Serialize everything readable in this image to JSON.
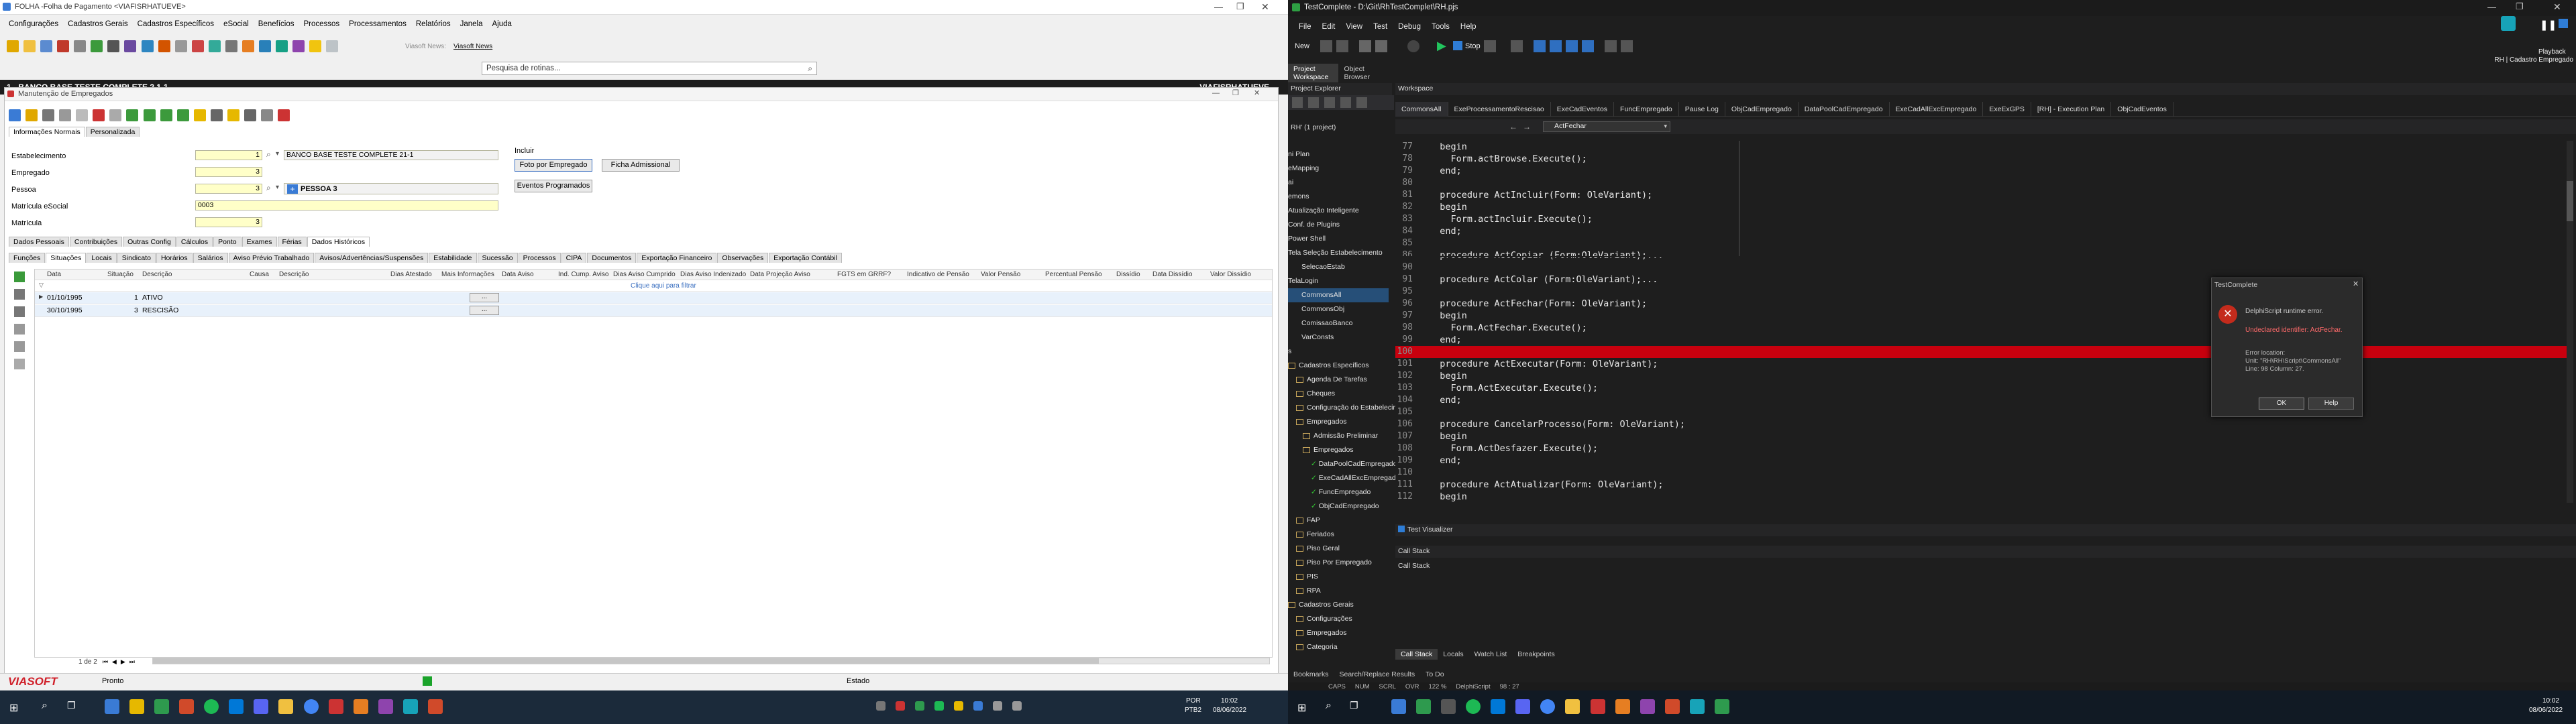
{
  "left": {
    "window_title": "FOLHA -Folha de Pagamento <VIAFISRHATUEVE>",
    "menu": [
      "Configurações",
      "Cadastros Gerais",
      "Cadastros Específicos",
      "eSocial",
      "Benefícios",
      "Processos",
      "Processamentos",
      "Relatórios",
      "Janela",
      "Ajuda"
    ],
    "viasoft_news_label": "Viasoft News:",
    "viasoft_news_link": "Viasoft News",
    "search_placeholder": "Pesquisa de rotinas...",
    "company_bar": "1 - BANCO BASE TESTE COMPLETE 2 1-1",
    "company_user": "VIAFISRHATUEVE",
    "subwindow_title": "Manutenção de Empregados",
    "top_tabs": [
      "Informações Normais",
      "Personalizada"
    ],
    "fields": {
      "estabelecimento_label": "Estabelecimento",
      "estabelecimento_value": "1",
      "estabelecimento_desc": "BANCO BASE TESTE COMPLETE 21-1",
      "empregado_label": "Empregado",
      "empregado_value": "3",
      "pessoa_label": "Pessoa",
      "pessoa_value": "3",
      "pessoa_desc": "PESSOA 3",
      "matricula_esocial_label": "Matrícula eSocial",
      "matricula_esocial_value": "0003",
      "matricula_label": "Matrícula",
      "matricula_value": "3"
    },
    "incluir_label": "Incluir",
    "buttons": [
      "Foto por Empregado",
      "Ficha Admissional",
      "Eventos Programados"
    ],
    "tabs_row1": [
      "Dados Pessoais",
      "Contribuições",
      "Outras Config",
      "Cálculos",
      "Ponto",
      "Exames",
      "Férias",
      "Dados Históricos"
    ],
    "tabs_row2": [
      "Funções",
      "Situações",
      "Locais",
      "Sindicato",
      "Horários",
      "Salários",
      "Aviso Prévio Trabalhado",
      "Avisos/Advertências/Suspensões",
      "Estabilidade",
      "Sucessão",
      "Processos",
      "CIPA",
      "Documentos",
      "Exportação Financeiro",
      "Observações",
      "Exportação Contábil"
    ],
    "grid_headers": [
      "Data",
      "Situação",
      "Descrição",
      "Causa",
      "Descrição",
      "Dias Atestado",
      "Mais Informações",
      "Data Aviso",
      "Ind. Cump. Aviso",
      "Dias Aviso Cumprido",
      "Dias Aviso Indenizado",
      "Data Projeção Aviso",
      "FGTS em GRRF?",
      "Indicativo de Pensão",
      "Valor Pensão",
      "Percentual Pensão",
      "Dissídio",
      "Data Dissídio",
      "Valor Dissídio"
    ],
    "grid_filter_hint": "Clique aqui para filtrar",
    "grid_rows": [
      {
        "data": "01/10/1995",
        "situacao": "1",
        "descricao": "ATIVO",
        "btn": "..."
      },
      {
        "data": "30/10/1995",
        "situacao": "3",
        "descricao": "RESCISÃO",
        "btn": "..."
      }
    ],
    "pager": "1 de 2",
    "status_brand": "VIASOFT",
    "status_text": "Pronto",
    "status_state": "Estado"
  },
  "right": {
    "window_title": "TestComplete - D:\\Git\\RhTestComplet\\RH.pjs",
    "menu": [
      "File",
      "Edit",
      "View",
      "Test",
      "Debug",
      "Tools",
      "Help"
    ],
    "new_label": "New",
    "stop_label": "Stop",
    "playback_label": "Playback",
    "project_label": "RH | Cadastro Empregado",
    "panel_tabs": [
      "Project Workspace",
      "Object Browser"
    ],
    "project_explorer_title": "Project Explorer",
    "project_root": "RH' (1 project)",
    "tree_items": [
      "ni Plan",
      "eMapping",
      "ai",
      "emons",
      "Atualização Inteligente",
      "Conf. de Plugins",
      "Power Shell",
      "Tela Seleção Estabelecimento",
      "SelecaoEstab",
      "TelaLogin",
      "CommonsAll",
      "CommonsObj",
      "ComissaoBanco",
      "VarConsts",
      "s",
      "Cadastros Específicos",
      "Agenda De Tarefas",
      "Cheques",
      "Configuração do Estabelecimento",
      "Empregados",
      "Admissão Preliminar",
      "Empregados",
      "DataPoolCadEmpregado",
      "ExeCadAllExcEmpregado",
      "FuncEmpregado",
      "ObjCadEmpregado",
      "FAP",
      "Feriados",
      "Piso Geral",
      "Piso Por Empregado",
      "PIS",
      "RPA",
      "Cadastros Gerais",
      "Configurações",
      "Empregados",
      "Categoria"
    ],
    "workspace_title": "Workspace",
    "editor_tabs": [
      "CommonsAll",
      "ExeProcessamentoRescisao",
      "ExeCadEventos",
      "FuncEmpregado",
      "Pause Log",
      "ObjCadEmpregado",
      "DataPoolCadEmpregado",
      "ExeCadAllExcEmpregado",
      "ExeExGPS",
      "[RH] - Execution Plan",
      "ObjCadEventos"
    ],
    "breadcrumb_fn": "ActFechar",
    "code_lines": [
      {
        "n": "77",
        "t": "  begin"
      },
      {
        "n": "78",
        "t": "    Form.actBrowse.Execute();"
      },
      {
        "n": "79",
        "t": "  end;"
      },
      {
        "n": "80",
        "t": ""
      },
      {
        "n": "81",
        "t": "  procedure ActIncluir(Form: OleVariant);"
      },
      {
        "n": "82",
        "t": "  begin"
      },
      {
        "n": "83",
        "t": "    Form.actIncluir.Execute();"
      },
      {
        "n": "84",
        "t": "  end;"
      },
      {
        "n": "85",
        "t": ""
      },
      {
        "n": "86",
        "t": "  procedure ActCopiar (Form:OleVariant);..."
      },
      {
        "n": "90",
        "t": ""
      },
      {
        "n": "91",
        "t": "  procedure ActColar (Form:OleVariant);..."
      },
      {
        "n": "95",
        "t": ""
      },
      {
        "n": "96",
        "t": "  procedure ActFechar(Form: OleVariant);"
      },
      {
        "n": "97",
        "t": "  begin"
      },
      {
        "n": "98",
        "t": "    Form.ActFechar.Execute();"
      },
      {
        "n": "99",
        "t": "  end;"
      },
      {
        "n": "100",
        "t": ""
      },
      {
        "n": "101",
        "t": "  procedure ActExecutar(Form: OleVariant);"
      },
      {
        "n": "102",
        "t": "  begin"
      },
      {
        "n": "103",
        "t": "    Form.ActExecutar.Execute();"
      },
      {
        "n": "104",
        "t": "  end;"
      },
      {
        "n": "105",
        "t": ""
      },
      {
        "n": "106",
        "t": "  procedure CancelarProcesso(Form: OleVariant);"
      },
      {
        "n": "107",
        "t": "  begin"
      },
      {
        "n": "108",
        "t": "    Form.ActDesfazer.Execute();"
      },
      {
        "n": "109",
        "t": "  end;"
      },
      {
        "n": "110",
        "t": ""
      },
      {
        "n": "111",
        "t": "  procedure ActAtualizar(Form: OleVariant);"
      },
      {
        "n": "112",
        "t": "  begin"
      }
    ],
    "error_line_index": 17,
    "dialog": {
      "title": "TestComplete",
      "line1": "DelphiScript runtime error.",
      "line2": "Undeclared identifier: ActFechar.",
      "loc1": "Error location:",
      "loc2": "Unit: \"RH\\RH\\Script\\CommonsAll\"",
      "loc3": "Line: 98 Column: 27.",
      "ok": "OK",
      "help": "Help"
    },
    "test_visualizer": "Test Visualizer",
    "call_stack_title": "Call Stack",
    "call_stack_header": "Call Stack",
    "bottom_tabs_left": [
      "Bookmarks",
      "Search/Replace Results",
      "To Do"
    ],
    "bottom_tabs": [
      "Call Stack",
      "Locals",
      "Watch List",
      "Breakpoints"
    ],
    "status": [
      "CAPS",
      "NUM",
      "SCRL",
      "OVR",
      "122 %",
      "DelphiScript",
      "98 : 27"
    ]
  },
  "taskbar_left": {
    "lang": "POR",
    "lang2": "PTB2",
    "time": "10:02",
    "date": "08/06/2022"
  },
  "taskbar_right": {
    "time": "10:02",
    "date": "08/06/2022"
  },
  "colors": {
    "error_red": "#c8000e",
    "ide_bg": "#1e1e1e",
    "field_yellow": "#ffffc8",
    "viasoft_red": "#d0202a"
  }
}
